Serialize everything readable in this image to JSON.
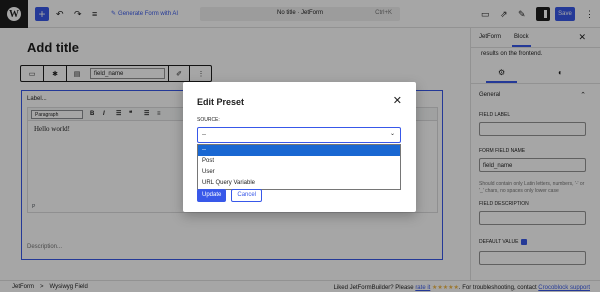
{
  "topbar": {
    "generate_label": "Generate Form with AI",
    "doc_title": "No title · JetForm",
    "shortcut": "Ctrl+K",
    "save_label": "Save"
  },
  "canvas": {
    "title_placeholder": "Add title",
    "field_name": "field_name",
    "block_label": "Label...",
    "paragraph_select": "Paragraph",
    "editor_text": "Hello world!",
    "editor_path": "P",
    "description_placeholder": "Description..."
  },
  "sidebar": {
    "tab_jetform": "JetForm",
    "tab_block": "Block",
    "note": "results on the frontend.",
    "section_general": "General",
    "field_label_label": "FIELD LABEL",
    "field_label_value": "",
    "form_field_name_label": "FORM FIELD NAME",
    "form_field_name_value": "field_name",
    "help_text": "Should contain only Latin letters, numbers, '-' or '_' chars, no spaces only lower case",
    "field_description_label": "FIELD DESCRIPTION",
    "field_description_value": "",
    "default_value_label": "DEFAULT VALUE",
    "default_value": ""
  },
  "statusbar": {
    "crumb_root": "JetForm",
    "crumb_sep": ">",
    "crumb_leaf": "Wysiwyg Field",
    "promo_prefix": "Liked JetFormBuilder? Please",
    "promo_link": "rate it",
    "promo_stars": "★★★★★",
    "promo_middle": ". For troubleshooting, contact",
    "promo_support": "Crocoblock support"
  },
  "modal": {
    "title": "Edit Preset",
    "source_label": "SOURCE:",
    "selected_value": "--",
    "options": [
      "--",
      "Post",
      "User",
      "URL Query Variable"
    ],
    "update_label": "Update",
    "cancel_label": "Cancel"
  }
}
